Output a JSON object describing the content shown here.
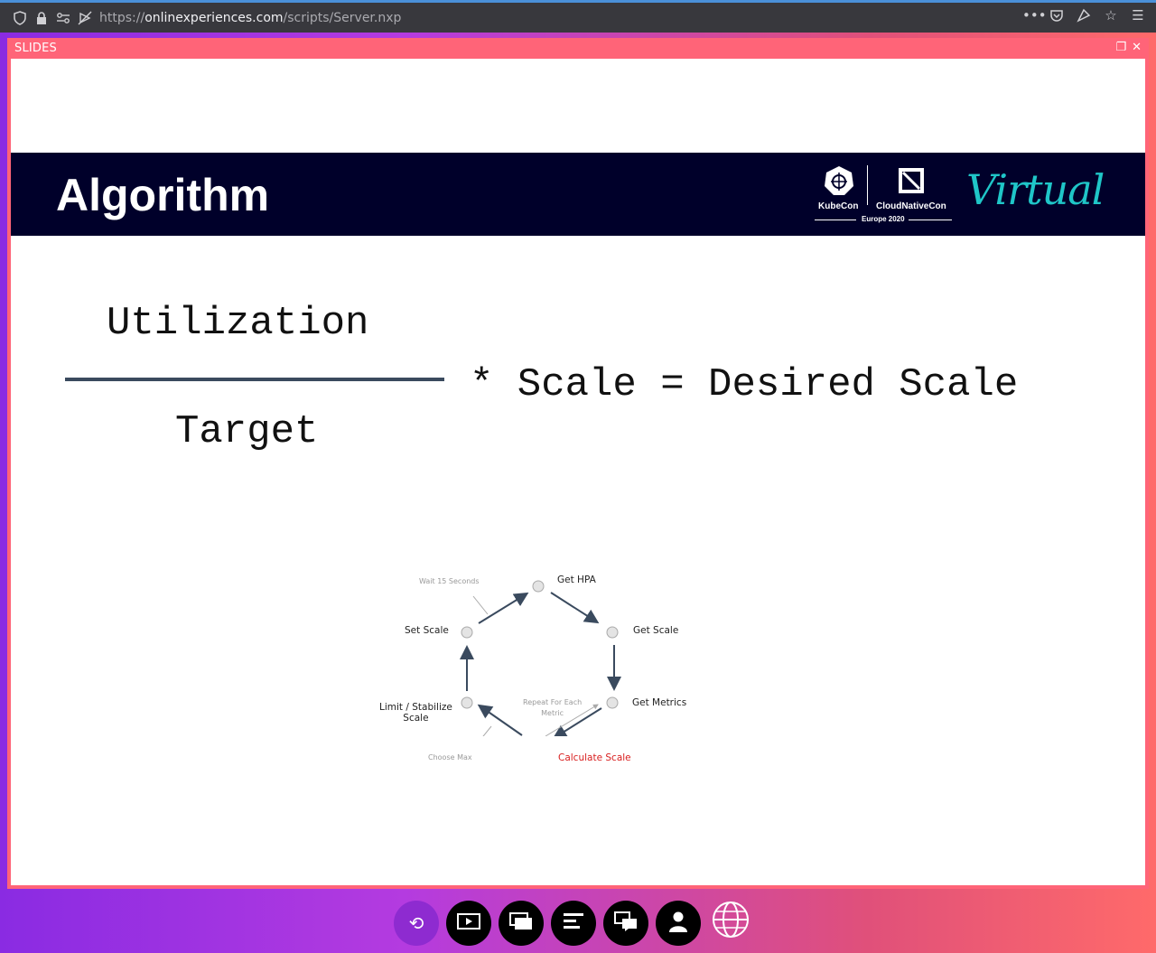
{
  "browser": {
    "url_scheme": "https://",
    "url_host": "onlinexperiences.com",
    "url_path": "/scripts/Server.nxp"
  },
  "panel": {
    "title": "SLIDES"
  },
  "slide": {
    "banner_title": "Algorithm",
    "logo_kubecon": "KubeCon",
    "logo_cncf": "CloudNativeCon",
    "logo_event": "Europe 2020",
    "logo_virtual": "Virtual",
    "numerator": "Utilization",
    "denominator": "Target",
    "rhs": "* Scale = Desired Scale"
  },
  "diagram": {
    "get_hpa": "Get HPA",
    "get_scale": "Get Scale",
    "get_metrics": "Get Metrics",
    "calculate_scale": "Calculate Scale",
    "limit_stabilize_1": "Limit / Stabilize",
    "limit_stabilize_2": "Scale",
    "set_scale": "Set Scale",
    "wait": "Wait 15 Seconds",
    "repeat_1": "Repeat For Each",
    "repeat_2": "Metric",
    "choose_max": "Choose Max",
    "accent_color": "#d81e1e"
  },
  "toolbar": {
    "buttons": [
      "refresh-icon",
      "play-video-icon",
      "slides-icon",
      "agenda-icon",
      "chat-icon",
      "profile-icon",
      "globe-icon"
    ]
  }
}
